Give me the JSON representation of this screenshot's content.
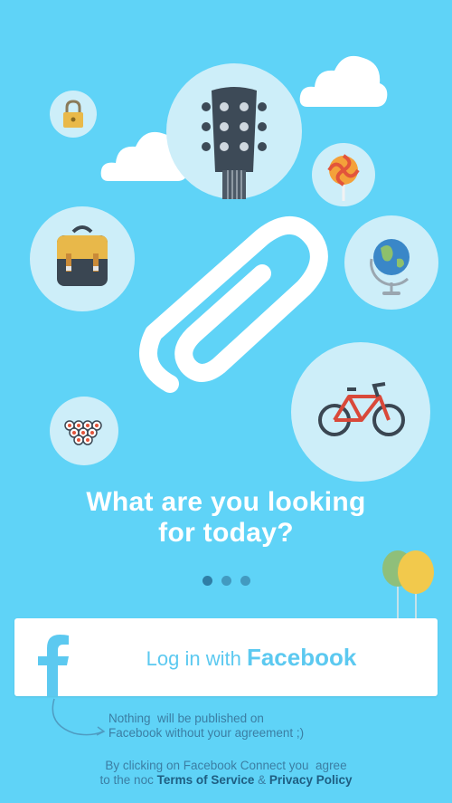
{
  "headline": {
    "line1": "What are you looking",
    "line2": "for today?"
  },
  "pager": {
    "count": 3,
    "active": 0
  },
  "login": {
    "label_prefix": "Log in with ",
    "label_brand": "Facebook"
  },
  "note": {
    "line1": "Nothing  will be published on",
    "line2": "Facebook without your agreement ;)"
  },
  "terms": {
    "line1": "By clicking on Facebook Connect you  agree",
    "line2_prefix": "to the noc ",
    "terms_link": "Terms of Service",
    "separator": " & ",
    "privacy_link": "Privacy Policy"
  },
  "colors": {
    "background": "#5fd3f7",
    "bubble": "#cdeef9",
    "facebook_blue": "#5cc9f0",
    "text_dark_blue": "#3b7ea3"
  }
}
